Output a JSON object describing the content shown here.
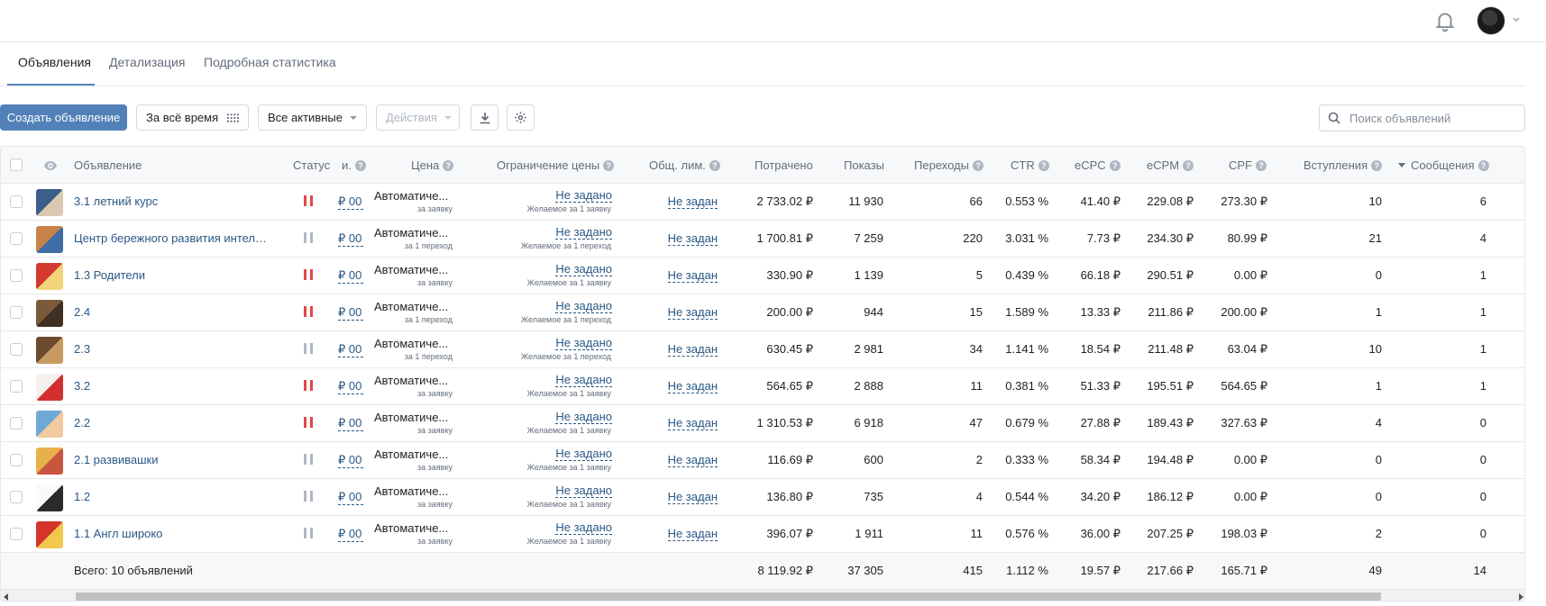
{
  "colors": {
    "accent": "#5181b8",
    "link": "#2a5885",
    "pause": "#e64646",
    "paused_gray": "#aeb7c2"
  },
  "header": {
    "bell_icon": "bell-icon",
    "avatar_icon": "avatar"
  },
  "tabs": [
    {
      "label": "Объявления",
      "active": true
    },
    {
      "label": "Детализация",
      "active": false
    },
    {
      "label": "Подробная статистика",
      "active": false
    }
  ],
  "toolbar": {
    "create_label": "Создать объявление",
    "period_label": "За всё время",
    "filter_label": "Все активные",
    "actions_label": "Действия",
    "search_placeholder": "Поиск объявлений"
  },
  "columns": {
    "ad": "Объявление",
    "status": "Статус",
    "cut": "и.",
    "price": "Цена",
    "price_limit": "Ограничение цены",
    "total_limit": "Общ. лим.",
    "spent": "Потрачено",
    "impressions": "Показы",
    "clicks": "Переходы",
    "ctr": "CTR",
    "ecpc": "eCPC",
    "ecpm": "eCPM",
    "cpf": "CPF",
    "joins": "Вступления",
    "messages": "Сообщения"
  },
  "rows": [
    {
      "name": "3.1 летний курс",
      "status": "active",
      "budget": "00 ₽",
      "price": "Автоматиче...",
      "price_sub": "за заявку",
      "limit": "Не задано",
      "limit_sub": "Желаемое за 1 заявку",
      "total_limit": "Не задан",
      "spent": "2 733.02 ₽",
      "impressions": "11 930",
      "clicks": "66",
      "ctr": "0.553 %",
      "ecpc": "41.40 ₽",
      "ecpm": "229.08 ₽",
      "cpf": "273.30 ₽",
      "joins": "10",
      "messages": "6"
    },
    {
      "name": "Центр бережного развития интеллекта",
      "status": "paused",
      "budget": "00 ₽",
      "price": "Автоматиче...",
      "price_sub": "за 1 переход",
      "limit": "Не задано",
      "limit_sub": "Желаемое за 1 переход",
      "total_limit": "Не задан",
      "spent": "1 700.81 ₽",
      "impressions": "7 259",
      "clicks": "220",
      "ctr": "3.031 %",
      "ecpc": "7.73 ₽",
      "ecpm": "234.30 ₽",
      "cpf": "80.99 ₽",
      "joins": "21",
      "messages": "4"
    },
    {
      "name": "1.3 Родители",
      "status": "active",
      "budget": "00 ₽",
      "price": "Автоматиче...",
      "price_sub": "за заявку",
      "limit": "Не задано",
      "limit_sub": "Желаемое за 1 заявку",
      "total_limit": "Не задан",
      "spent": "330.90 ₽",
      "impressions": "1 139",
      "clicks": "5",
      "ctr": "0.439 %",
      "ecpc": "66.18 ₽",
      "ecpm": "290.51 ₽",
      "cpf": "0.00 ₽",
      "joins": "0",
      "messages": "1"
    },
    {
      "name": "2.4",
      "status": "active",
      "budget": "00 ₽",
      "price": "Автоматиче...",
      "price_sub": "за 1 переход",
      "limit": "Не задано",
      "limit_sub": "Желаемое за 1 переход",
      "total_limit": "Не задан",
      "spent": "200.00 ₽",
      "impressions": "944",
      "clicks": "15",
      "ctr": "1.589 %",
      "ecpc": "13.33 ₽",
      "ecpm": "211.86 ₽",
      "cpf": "200.00 ₽",
      "joins": "1",
      "messages": "1"
    },
    {
      "name": "2.3",
      "status": "paused",
      "budget": "00 ₽",
      "price": "Автоматиче...",
      "price_sub": "за 1 переход",
      "limit": "Не задано",
      "limit_sub": "Желаемое за 1 переход",
      "total_limit": "Не задан",
      "spent": "630.45 ₽",
      "impressions": "2 981",
      "clicks": "34",
      "ctr": "1.141 %",
      "ecpc": "18.54 ₽",
      "ecpm": "211.48 ₽",
      "cpf": "63.04 ₽",
      "joins": "10",
      "messages": "1"
    },
    {
      "name": "3.2",
      "status": "active",
      "budget": "00 ₽",
      "price": "Автоматиче...",
      "price_sub": "за заявку",
      "limit": "Не задано",
      "limit_sub": "Желаемое за 1 заявку",
      "total_limit": "Не задан",
      "spent": "564.65 ₽",
      "impressions": "2 888",
      "clicks": "11",
      "ctr": "0.381 %",
      "ecpc": "51.33 ₽",
      "ecpm": "195.51 ₽",
      "cpf": "564.65 ₽",
      "joins": "1",
      "messages": "1"
    },
    {
      "name": "2.2",
      "status": "active",
      "budget": "00 ₽",
      "price": "Автоматиче...",
      "price_sub": "за заявку",
      "limit": "Не задано",
      "limit_sub": "Желаемое за 1 заявку",
      "total_limit": "Не задан",
      "spent": "1 310.53 ₽",
      "impressions": "6 918",
      "clicks": "47",
      "ctr": "0.679 %",
      "ecpc": "27.88 ₽",
      "ecpm": "189.43 ₽",
      "cpf": "327.63 ₽",
      "joins": "4",
      "messages": "0"
    },
    {
      "name": "2.1 развивашки",
      "status": "paused",
      "budget": "00 ₽",
      "price": "Автоматиче...",
      "price_sub": "за заявку",
      "limit": "Не задано",
      "limit_sub": "Желаемое за 1 заявку",
      "total_limit": "Не задан",
      "spent": "116.69 ₽",
      "impressions": "600",
      "clicks": "2",
      "ctr": "0.333 %",
      "ecpc": "58.34 ₽",
      "ecpm": "194.48 ₽",
      "cpf": "0.00 ₽",
      "joins": "0",
      "messages": "0"
    },
    {
      "name": "1.2",
      "status": "paused",
      "budget": "00 ₽",
      "price": "Автоматиче...",
      "price_sub": "за заявку",
      "limit": "Не задано",
      "limit_sub": "Желаемое за 1 заявку",
      "total_limit": "Не задан",
      "spent": "136.80 ₽",
      "impressions": "735",
      "clicks": "4",
      "ctr": "0.544 %",
      "ecpc": "34.20 ₽",
      "ecpm": "186.12 ₽",
      "cpf": "0.00 ₽",
      "joins": "0",
      "messages": "0"
    },
    {
      "name": "1.1 Англ широко",
      "status": "paused",
      "budget": "00 ₽",
      "price": "Автоматиче...",
      "price_sub": "за заявку",
      "limit": "Не задано",
      "limit_sub": "Желаемое за 1 заявку",
      "total_limit": "Не задан",
      "spent": "396.07 ₽",
      "impressions": "1 911",
      "clicks": "11",
      "ctr": "0.576 %",
      "ecpc": "36.00 ₽",
      "ecpm": "207.25 ₽",
      "cpf": "198.03 ₽",
      "joins": "2",
      "messages": "0"
    }
  ],
  "thumbs": [
    [
      "#3b5e8c",
      "#d9c9b0"
    ],
    [
      "#c9834a",
      "#3d6ea8"
    ],
    [
      "#d23a2f",
      "#f1d47a"
    ],
    [
      "#7a5a3a",
      "#3f3023"
    ],
    [
      "#6b4a2e",
      "#c89a62"
    ],
    [
      "#f4f1ee",
      "#d32f2f"
    ],
    [
      "#6fa8d6",
      "#f3c9a1"
    ],
    [
      "#e8b04b",
      "#c8553d"
    ],
    [
      "#fafafa",
      "#2b2b2b"
    ],
    [
      "#d4342a",
      "#f2c94c"
    ]
  ],
  "totals": {
    "label": "Всего: 10 объявлений",
    "spent": "8 119.92 ₽",
    "impressions": "37 305",
    "clicks": "415",
    "ctr": "1.112 %",
    "ecpc": "19.57 ₽",
    "ecpm": "217.66 ₽",
    "cpf": "165.71 ₽",
    "joins": "49",
    "messages": "14"
  }
}
